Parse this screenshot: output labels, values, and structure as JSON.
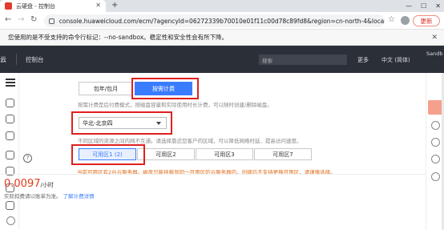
{
  "browser": {
    "tab_title": "云硬盘 - 控制台",
    "url": "console.huaweicloud.com/ecm/?agencyId=06272339b70010e01f11c00d78c89fd8&region=cn-north-4&locale=z···",
    "update_label": "更新",
    "info_message": "您使用的是不受支持的命令行标记：--no-sandbox。稳定性和安全性会有所下降。"
  },
  "header": {
    "logo_text": "云",
    "console_label": "控制台",
    "search_placeholder": "搜索",
    "more_label": "更多",
    "language_label": "中文 (简体)",
    "user_label": "Sandb"
  },
  "billing": {
    "options": [
      "包年/包月",
      "按需计费"
    ],
    "selected": "按需计费",
    "description": "按需计费是后付费模式，按磁盘容量和实际使用时长计费，可以随时创建/删除磁盘。"
  },
  "region": {
    "selected": "华北-北京四",
    "description": "不同区域的资源之间内网不互通。请选择靠近您客户的区域，可以降低网络时延、提高访问速度。"
  },
  "availability_zone": {
    "zones": [
      "可用区1 (2)",
      "可用区2",
      "可用区3",
      "可用区7"
    ],
    "selected": "可用区1 (2)",
    "warning": "当前可用区有2台云服务器。磁盘只能挂载到同一可用区的云服务器内，创建后不支持更换可用区，请谨慎选择。"
  },
  "price": {
    "amount": "0.0097",
    "unit": "/小时",
    "note": "实际扣费请以账单为准。",
    "link": "了解计费详情"
  },
  "colors": {
    "primary": "#3a7cff",
    "highlight": "#e02020",
    "price": "#e5391b",
    "header_bg": "#2b2f38"
  }
}
